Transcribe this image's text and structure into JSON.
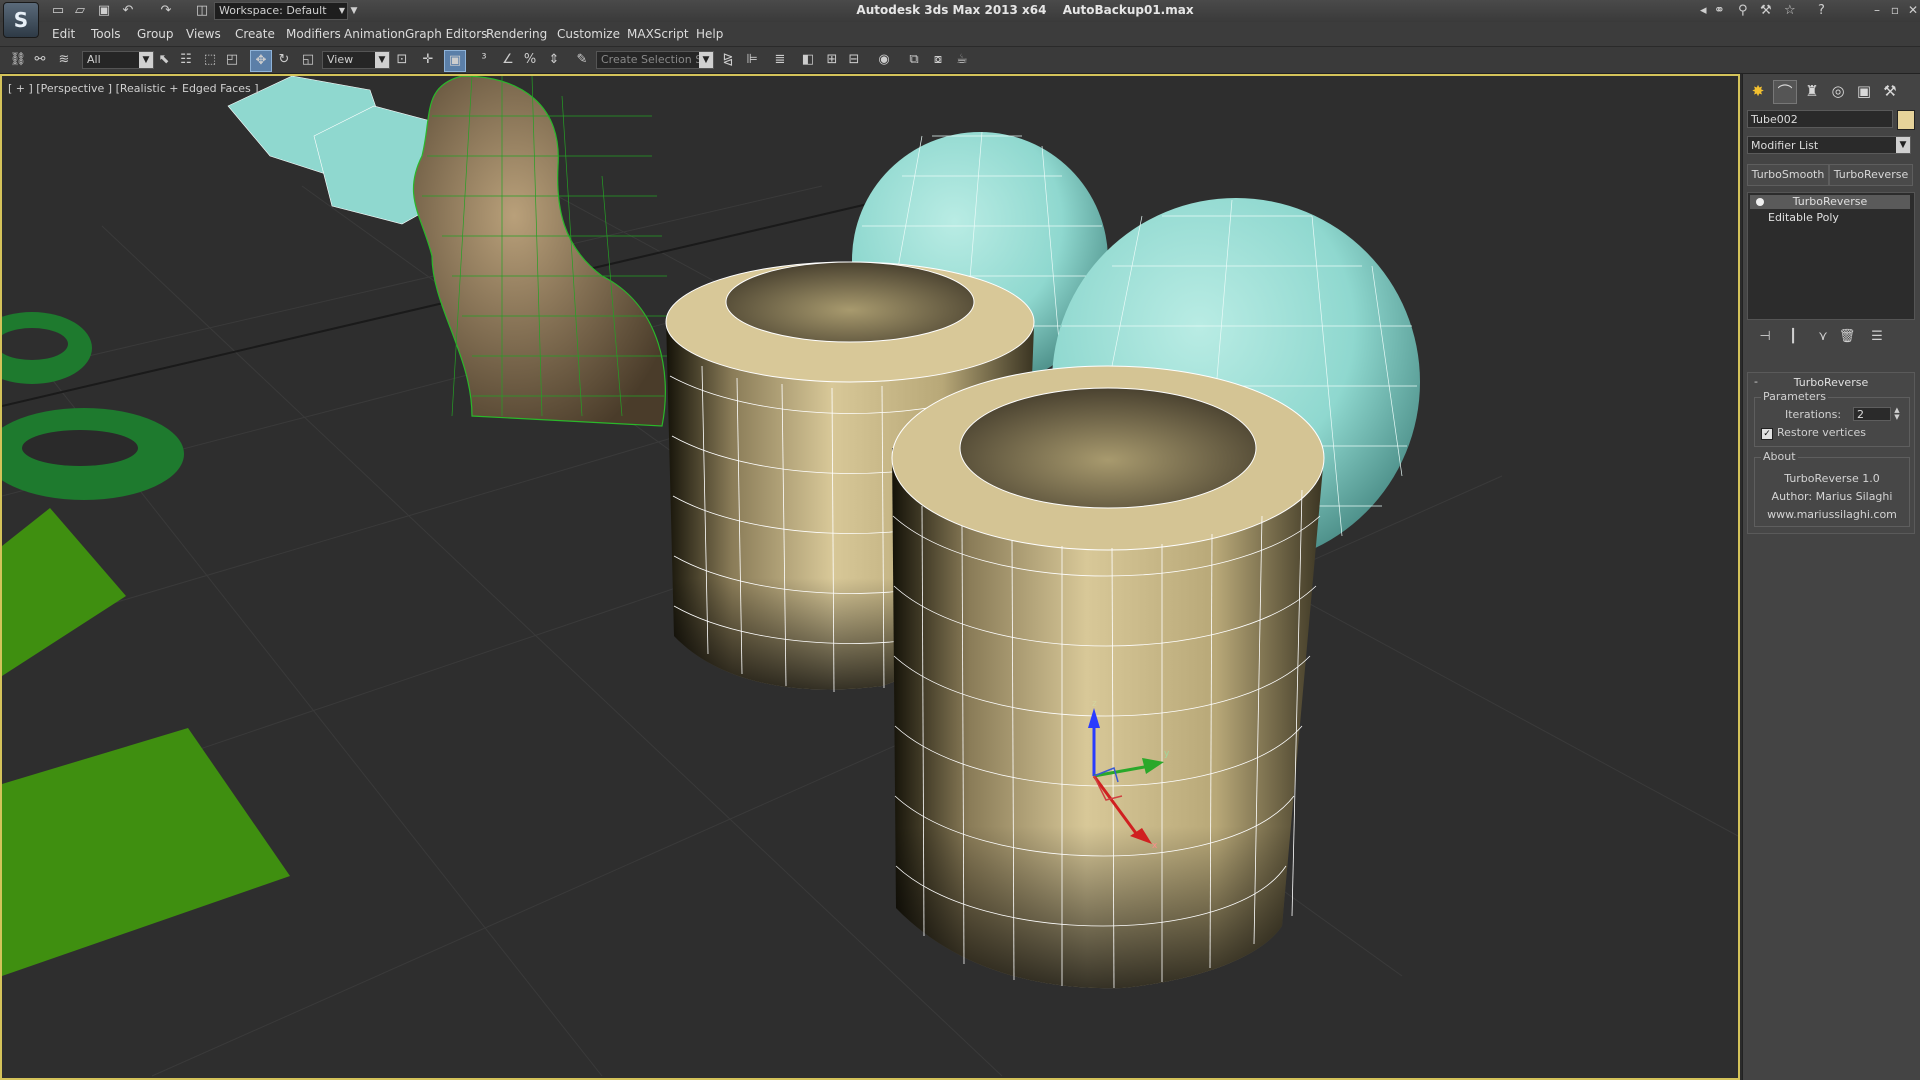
{
  "app": {
    "logo_glyph": "S",
    "title": "Autodesk 3ds Max  2013 x64",
    "file": "AutoBackup01.max",
    "workspace": "Workspace: Default"
  },
  "menus": [
    "Edit",
    "Tools",
    "Group",
    "Views",
    "Create",
    "Modifiers",
    "Animation",
    "Graph Editors",
    "Rendering",
    "Customize",
    "MAXScript",
    "Help"
  ],
  "toolbar": {
    "selection_filter": "All",
    "ref_coord": "View",
    "named_selection_placeholder": "Create Selection Se"
  },
  "viewport": {
    "label": "[ + ] [Perspective ] [Realistic + Edged Faces ]",
    "gizmo_axes": [
      "z",
      "y",
      "x"
    ]
  },
  "command_panel": {
    "object_name": "Tube002",
    "object_color": "#e6d39a",
    "modifier_list": "Modifier List",
    "quick_buttons": [
      "TurboSmooth",
      "TurboReverse"
    ],
    "stack": [
      {
        "label": "TurboReverse",
        "selected": true
      },
      {
        "label": "Editable Poly",
        "selected": false
      }
    ],
    "rollout": {
      "title": "TurboReverse",
      "parameters_label": "Parameters",
      "iterations_label": "Iterations:",
      "iterations_value": "2",
      "restore_label": "Restore vertices",
      "restore_checked": true,
      "about_label": "About",
      "about_lines": [
        "TurboReverse 1.0",
        "Author: Marius Silaghi",
        "www.mariussilaghi.com"
      ]
    }
  },
  "colors": {
    "viewport_border": "#d4c35a",
    "tube": "#d8c898",
    "sphere": "#8fd8cf",
    "green_objects": "#2e8a2e"
  }
}
